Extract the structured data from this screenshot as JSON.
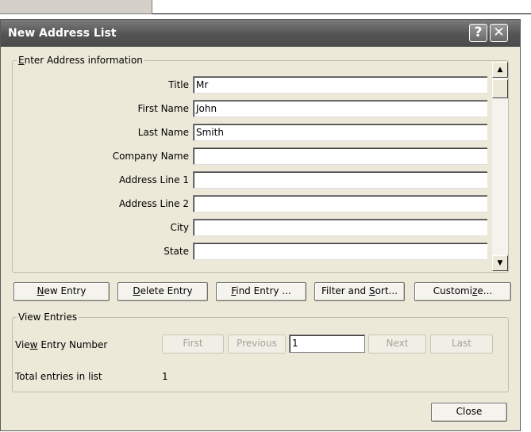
{
  "dialog": {
    "title": "New Address List",
    "help_glyph": "?",
    "close_glyph": "✕"
  },
  "address_group": {
    "label_accel": "E",
    "label_rest": "nter Address information",
    "fields": [
      {
        "label": "Title",
        "value": "Mr"
      },
      {
        "label": "First Name",
        "value": "John"
      },
      {
        "label": "Last Name",
        "value": "Smith"
      },
      {
        "label": "Company Name",
        "value": ""
      },
      {
        "label": "Address Line 1",
        "value": ""
      },
      {
        "label": "Address Line 2",
        "value": ""
      },
      {
        "label": "City",
        "value": ""
      },
      {
        "label": "State",
        "value": ""
      }
    ],
    "scroll_up_glyph": "▲",
    "scroll_down_glyph": "▼"
  },
  "actions": {
    "new_entry": {
      "accel": "N",
      "rest": "ew Entry"
    },
    "delete_entry": {
      "accel": "D",
      "rest": "elete Entry"
    },
    "find_entry": {
      "accel": "F",
      "rest": "ind Entry ..."
    },
    "filter_sort": {
      "pre": "Filter and ",
      "accel": "S",
      "rest": "ort..."
    },
    "customize": {
      "pre": "Customi",
      "accel": "z",
      "rest": "e..."
    }
  },
  "view_entries": {
    "group_label": "View Entries",
    "entry_number_label_pre": "Vie",
    "entry_number_label_accel": "w",
    "entry_number_label_rest": " Entry Number",
    "first": "First",
    "previous": "Previous",
    "entry_number": "1",
    "next": "Next",
    "last": "Last",
    "total_label": "Total entries in list",
    "total_value": "1"
  },
  "close_label": "Close"
}
